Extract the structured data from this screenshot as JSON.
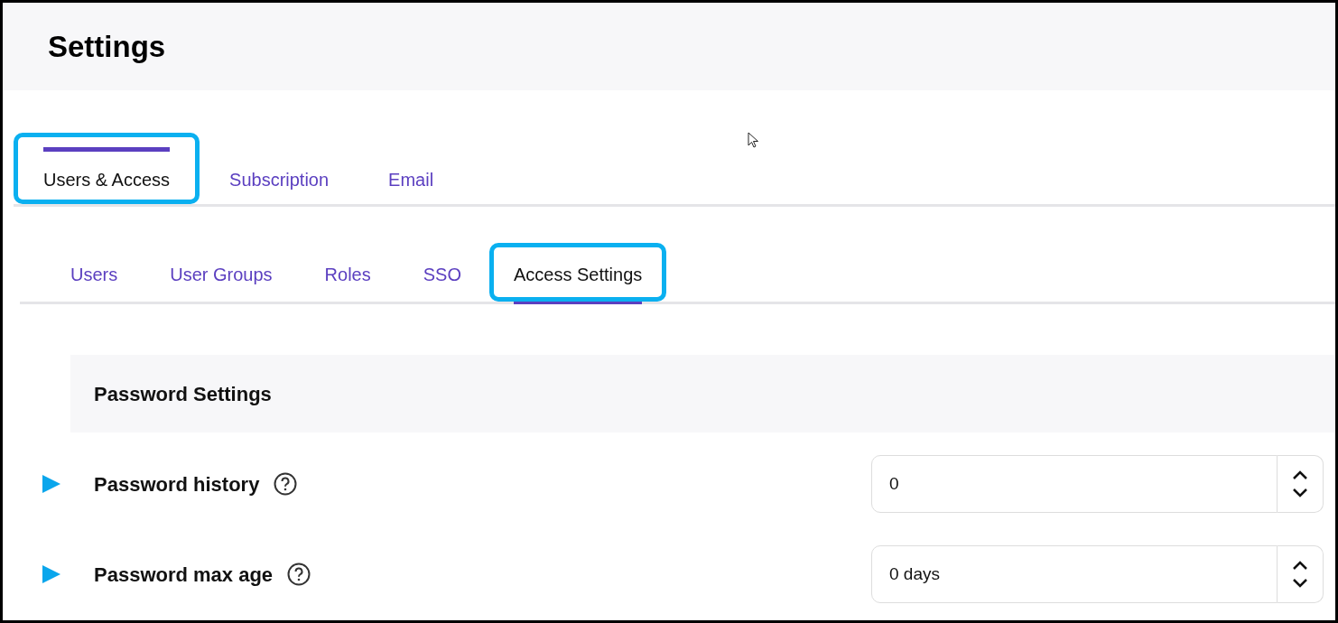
{
  "page": {
    "title": "Settings"
  },
  "tabs": [
    {
      "label": "Users & Access",
      "selected": true,
      "highlighted": true
    },
    {
      "label": "Subscription",
      "selected": false,
      "highlighted": false
    },
    {
      "label": "Email",
      "selected": false,
      "highlighted": false
    }
  ],
  "subtabs": [
    {
      "label": "Users",
      "selected": false,
      "highlighted": false
    },
    {
      "label": "User Groups",
      "selected": false,
      "highlighted": false
    },
    {
      "label": "Roles",
      "selected": false,
      "highlighted": false
    },
    {
      "label": "SSO",
      "selected": false,
      "highlighted": false
    },
    {
      "label": "Access Settings",
      "selected": true,
      "highlighted": true
    }
  ],
  "section": {
    "title": "Password Settings"
  },
  "settings": [
    {
      "label": "Password history",
      "value": "0",
      "marked": true
    },
    {
      "label": "Password max age",
      "value": "0 days",
      "marked": true
    }
  ]
}
